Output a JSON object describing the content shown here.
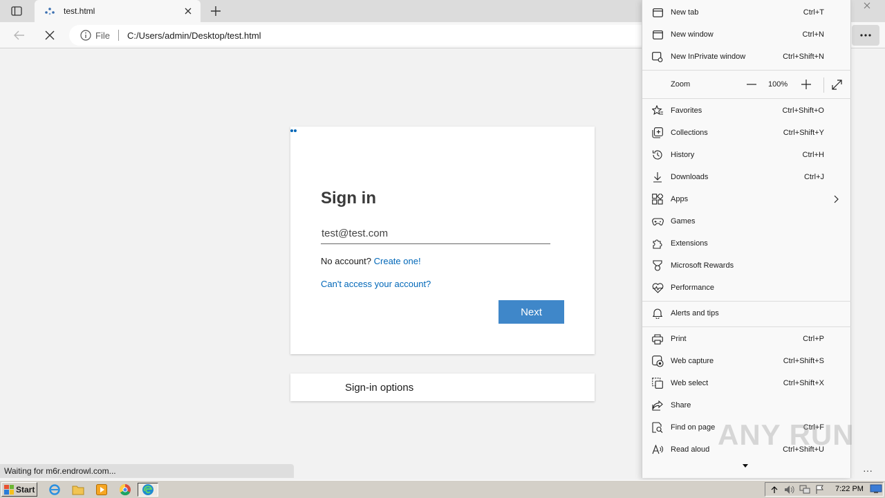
{
  "browser": {
    "tab": {
      "title": "test.html"
    },
    "address": {
      "site_info_label": "File",
      "url": "C:/Users/admin/Desktop/test.html"
    }
  },
  "page": {
    "signin_title": "Sign in",
    "email_value": "test@test.com",
    "no_account_text": "No account?",
    "create_link": "Create one!",
    "cant_access_link": "Can't access your account?",
    "next_label": "Next",
    "signin_options_label": "Sign-in options"
  },
  "status_text": "Waiting for m6r.endrowl.com...",
  "menu": {
    "new_tab": {
      "label": "New tab",
      "shortcut": "Ctrl+T",
      "icon": "new-tab-icon"
    },
    "new_window": {
      "label": "New window",
      "shortcut": "Ctrl+N",
      "icon": "new-window-icon"
    },
    "new_inprivate": {
      "label": "New InPrivate window",
      "shortcut": "Ctrl+Shift+N",
      "icon": "inprivate-icon"
    },
    "zoom": {
      "label": "Zoom",
      "value": "100%"
    },
    "favorites": {
      "label": "Favorites",
      "shortcut": "Ctrl+Shift+O",
      "icon": "favorites-icon"
    },
    "collections": {
      "label": "Collections",
      "shortcut": "Ctrl+Shift+Y",
      "icon": "collections-icon"
    },
    "history": {
      "label": "History",
      "shortcut": "Ctrl+H",
      "icon": "history-icon"
    },
    "downloads": {
      "label": "Downloads",
      "shortcut": "Ctrl+J",
      "icon": "downloads-icon"
    },
    "apps": {
      "label": "Apps",
      "icon": "apps-icon"
    },
    "games": {
      "label": "Games",
      "icon": "games-icon"
    },
    "extensions": {
      "label": "Extensions",
      "icon": "extensions-icon"
    },
    "rewards": {
      "label": "Microsoft Rewards",
      "icon": "rewards-icon"
    },
    "performance": {
      "label": "Performance",
      "icon": "performance-icon"
    },
    "alerts": {
      "label": "Alerts and tips",
      "icon": "bell-icon"
    },
    "print": {
      "label": "Print",
      "shortcut": "Ctrl+P",
      "icon": "print-icon"
    },
    "web_capture": {
      "label": "Web capture",
      "shortcut": "Ctrl+Shift+S",
      "icon": "web-capture-icon"
    },
    "web_select": {
      "label": "Web select",
      "shortcut": "Ctrl+Shift+X",
      "icon": "web-select-icon"
    },
    "share": {
      "label": "Share",
      "icon": "share-icon"
    },
    "find": {
      "label": "Find on page",
      "shortcut": "Ctrl+F",
      "icon": "find-icon"
    },
    "read_aloud": {
      "label": "Read aloud",
      "shortcut": "Ctrl+Shift+U",
      "icon": "read-aloud-icon"
    }
  },
  "watermark": "ANY RUN",
  "taskbar": {
    "start_label": "Start",
    "clock": "7:22 PM"
  },
  "colors": {
    "accent_blue": "#0067b8",
    "next_button": "#3f87c9"
  }
}
